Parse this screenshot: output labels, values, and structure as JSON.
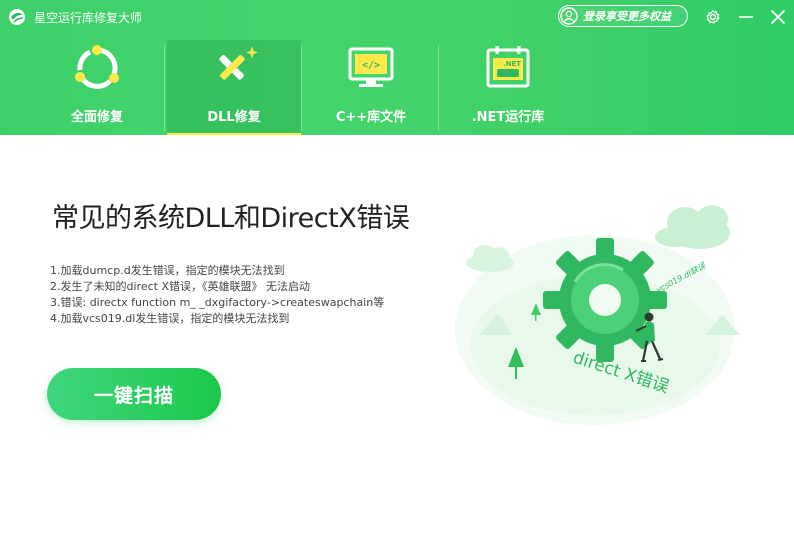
{
  "app": {
    "title": "星空运行库修复大师"
  },
  "header": {
    "login_label": "登录享受更多权益"
  },
  "tabs": [
    {
      "label": "全面修复",
      "icon": "recycle-icon"
    },
    {
      "label": "DLL修复",
      "icon": "dll-cross-icon",
      "active": true
    },
    {
      "label": "C++库文件",
      "icon": "code-monitor-icon"
    },
    {
      "label": ".NET运行库",
      "icon": "net-calendar-icon",
      "icon_text": ".NET"
    }
  ],
  "main": {
    "title": "常见的系统DLL和DirectX错误",
    "errors": [
      "1.加载dumcp.d发生错误，指定的模块无法找到",
      "2.发生了未知的direct X错误，《英雄联盟》 无法启动",
      "3.错误: directx function m_ _dxgifactory->createswapchain等",
      "4.加载vcs019.dl发生错误，指定的模块无法找到"
    ],
    "scan_button": "一键扫描"
  },
  "illustration": {
    "floor_text": "direct X错误",
    "gear_text": "vcs019.dl缺误"
  },
  "colors": {
    "brand_green": "#3dd06a",
    "button_green": "#1bc84a",
    "accent_yellow": "#ffe94a"
  }
}
